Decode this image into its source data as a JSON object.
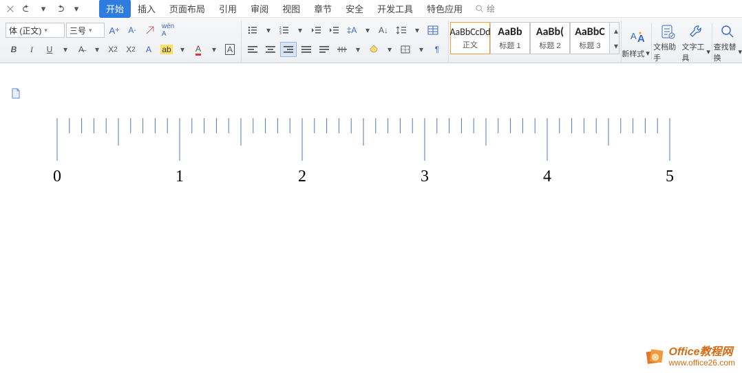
{
  "quick_access": {
    "undo_hint": "↶",
    "redo_hint": "↷"
  },
  "tabs": [
    {
      "label": "开始",
      "active": true
    },
    {
      "label": "插入"
    },
    {
      "label": "页面布局"
    },
    {
      "label": "引用"
    },
    {
      "label": "审阅"
    },
    {
      "label": "视图"
    },
    {
      "label": "章节"
    },
    {
      "label": "安全"
    },
    {
      "label": "开发工具"
    },
    {
      "label": "特色应用"
    }
  ],
  "search": {
    "placeholder": "绘"
  },
  "font": {
    "name": "体 (正文)",
    "size": "三号"
  },
  "font_buttons": {
    "grow": "A+",
    "shrink": "A-"
  },
  "format": {
    "bold": "B",
    "italic": "I",
    "underline": "U",
    "strike": "A",
    "super": "X²",
    "sub": "X₂"
  },
  "style_gallery": [
    {
      "preview": "AaBbCcDd",
      "name": "正文",
      "bold": false,
      "selected": true
    },
    {
      "preview": "AaBb",
      "name": "标题 1",
      "bold": true
    },
    {
      "preview": "AaBb(",
      "name": "标题 2",
      "bold": true
    },
    {
      "preview": "AaBbC",
      "name": "标题 3",
      "bold": true
    }
  ],
  "large_buttons": {
    "new_style": "新样式",
    "doc_helper": "文档助手",
    "text_tool": "文字工具",
    "find_replace": "查找替换"
  },
  "ruler": {
    "labels": [
      "0",
      "1",
      "2",
      "3",
      "4",
      "5"
    ]
  },
  "watermark": {
    "line1": "Office教程网",
    "line2": "www.office26.com"
  }
}
